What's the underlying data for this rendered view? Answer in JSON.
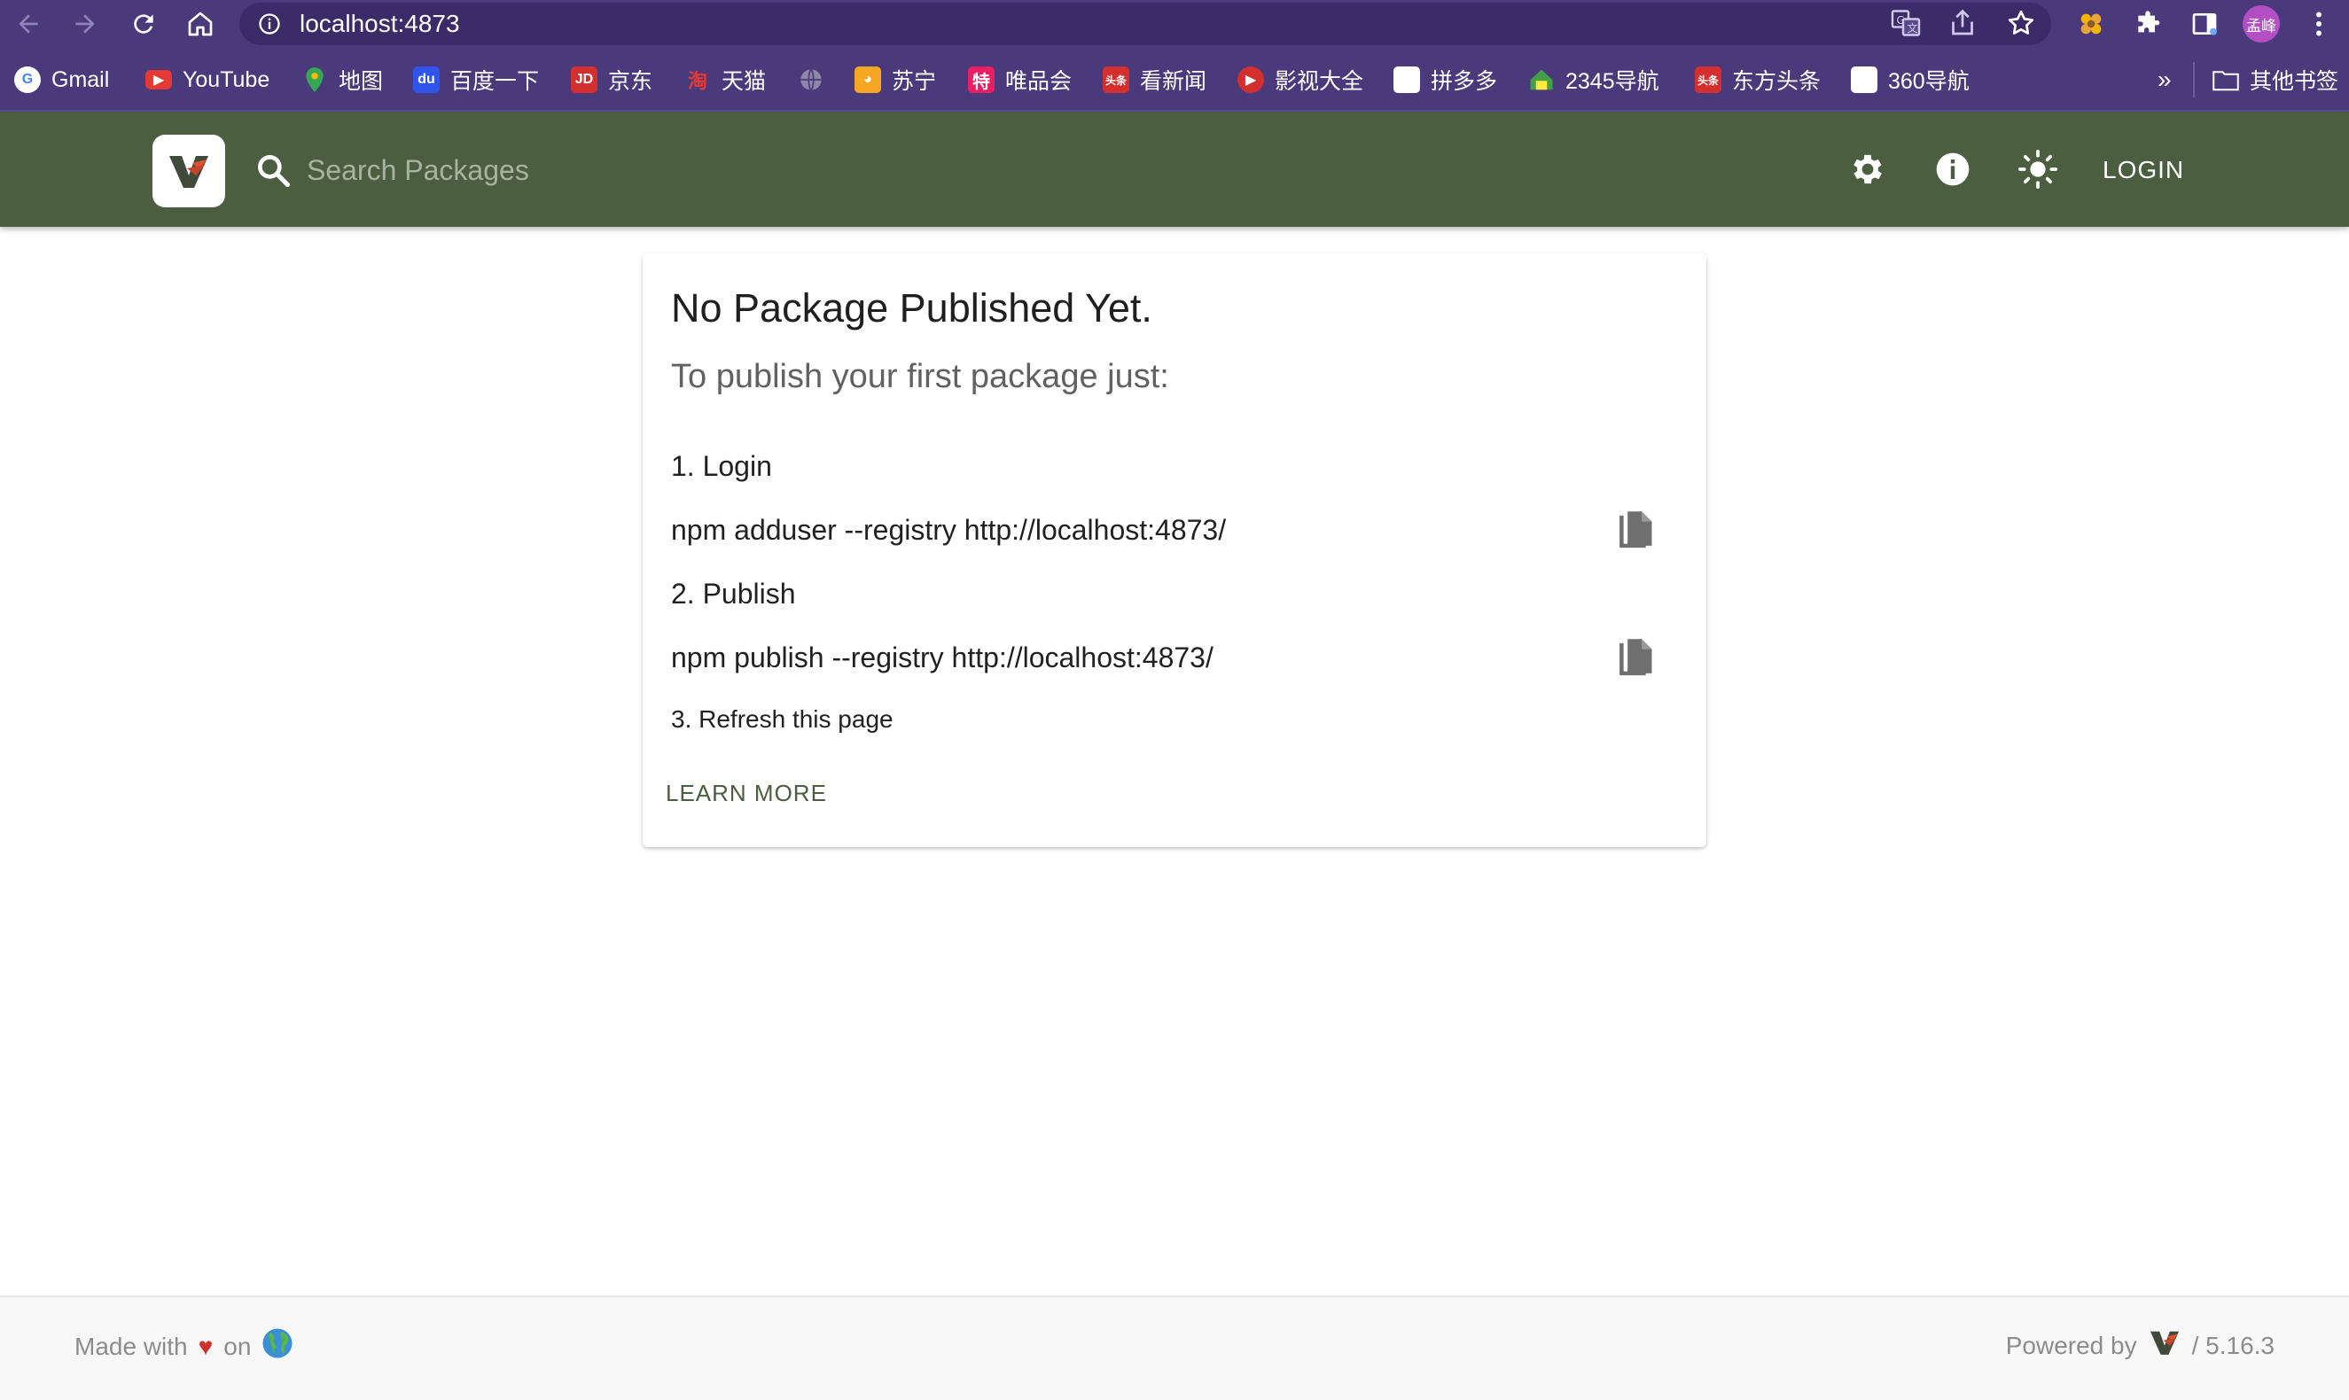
{
  "browser": {
    "url": "localhost:4873",
    "avatar_label": "孟峰",
    "bookmarks": [
      {
        "label": "Gmail",
        "icon": "google-icon",
        "color": "#ffffff"
      },
      {
        "label": "YouTube",
        "icon": "youtube-icon",
        "color": "#e53935"
      },
      {
        "label": "地图",
        "icon": "map-pin-icon",
        "color": "#34a853"
      },
      {
        "label": "百度一下",
        "icon": "baidu-icon",
        "color": "#2f54eb"
      },
      {
        "label": "京东",
        "icon": "jd-icon",
        "color": "#d32f2f"
      },
      {
        "label": "天猫",
        "icon": "tmall-icon",
        "color": "#e53935"
      },
      {
        "label": "",
        "icon": "globe-icon",
        "color": "#9e9e9e"
      },
      {
        "label": "苏宁",
        "icon": "suning-icon",
        "color": "#f5a623"
      },
      {
        "label": "唯品会",
        "icon": "vip-icon",
        "color": "#e91e63"
      },
      {
        "label": "看新闻",
        "icon": "news-icon",
        "color": "#d32f2f"
      },
      {
        "label": "影视大全",
        "icon": "video-icon",
        "color": "#d32f2f"
      },
      {
        "label": "拼多多",
        "icon": "blank-page-icon",
        "color": "#ffffff"
      },
      {
        "label": "2345导航",
        "icon": "house-icon",
        "color": "#43a047"
      },
      {
        "label": "东方头条",
        "icon": "toutiao-icon",
        "color": "#d32f2f"
      },
      {
        "label": "360导航",
        "icon": "blank-page-icon",
        "color": "#ffffff"
      }
    ],
    "more_label": "»",
    "other_bookmarks": "其他书签"
  },
  "header": {
    "search_placeholder": "Search Packages",
    "login_label": "LOGIN",
    "accent_color": "#4b5e40"
  },
  "card": {
    "title": "No Package Published Yet.",
    "subtitle": "To publish your first package just:",
    "step1": "1. Login",
    "cmd1": "npm adduser --registry http://localhost:4873/",
    "step2": "2. Publish",
    "cmd2": "npm publish --registry http://localhost:4873/",
    "step3": "3. Refresh this page",
    "learn_more": "LEARN MORE"
  },
  "footer": {
    "made_with": "Made with",
    "on": "on",
    "powered_by": "Powered by",
    "version": "/ 5.16.3"
  }
}
